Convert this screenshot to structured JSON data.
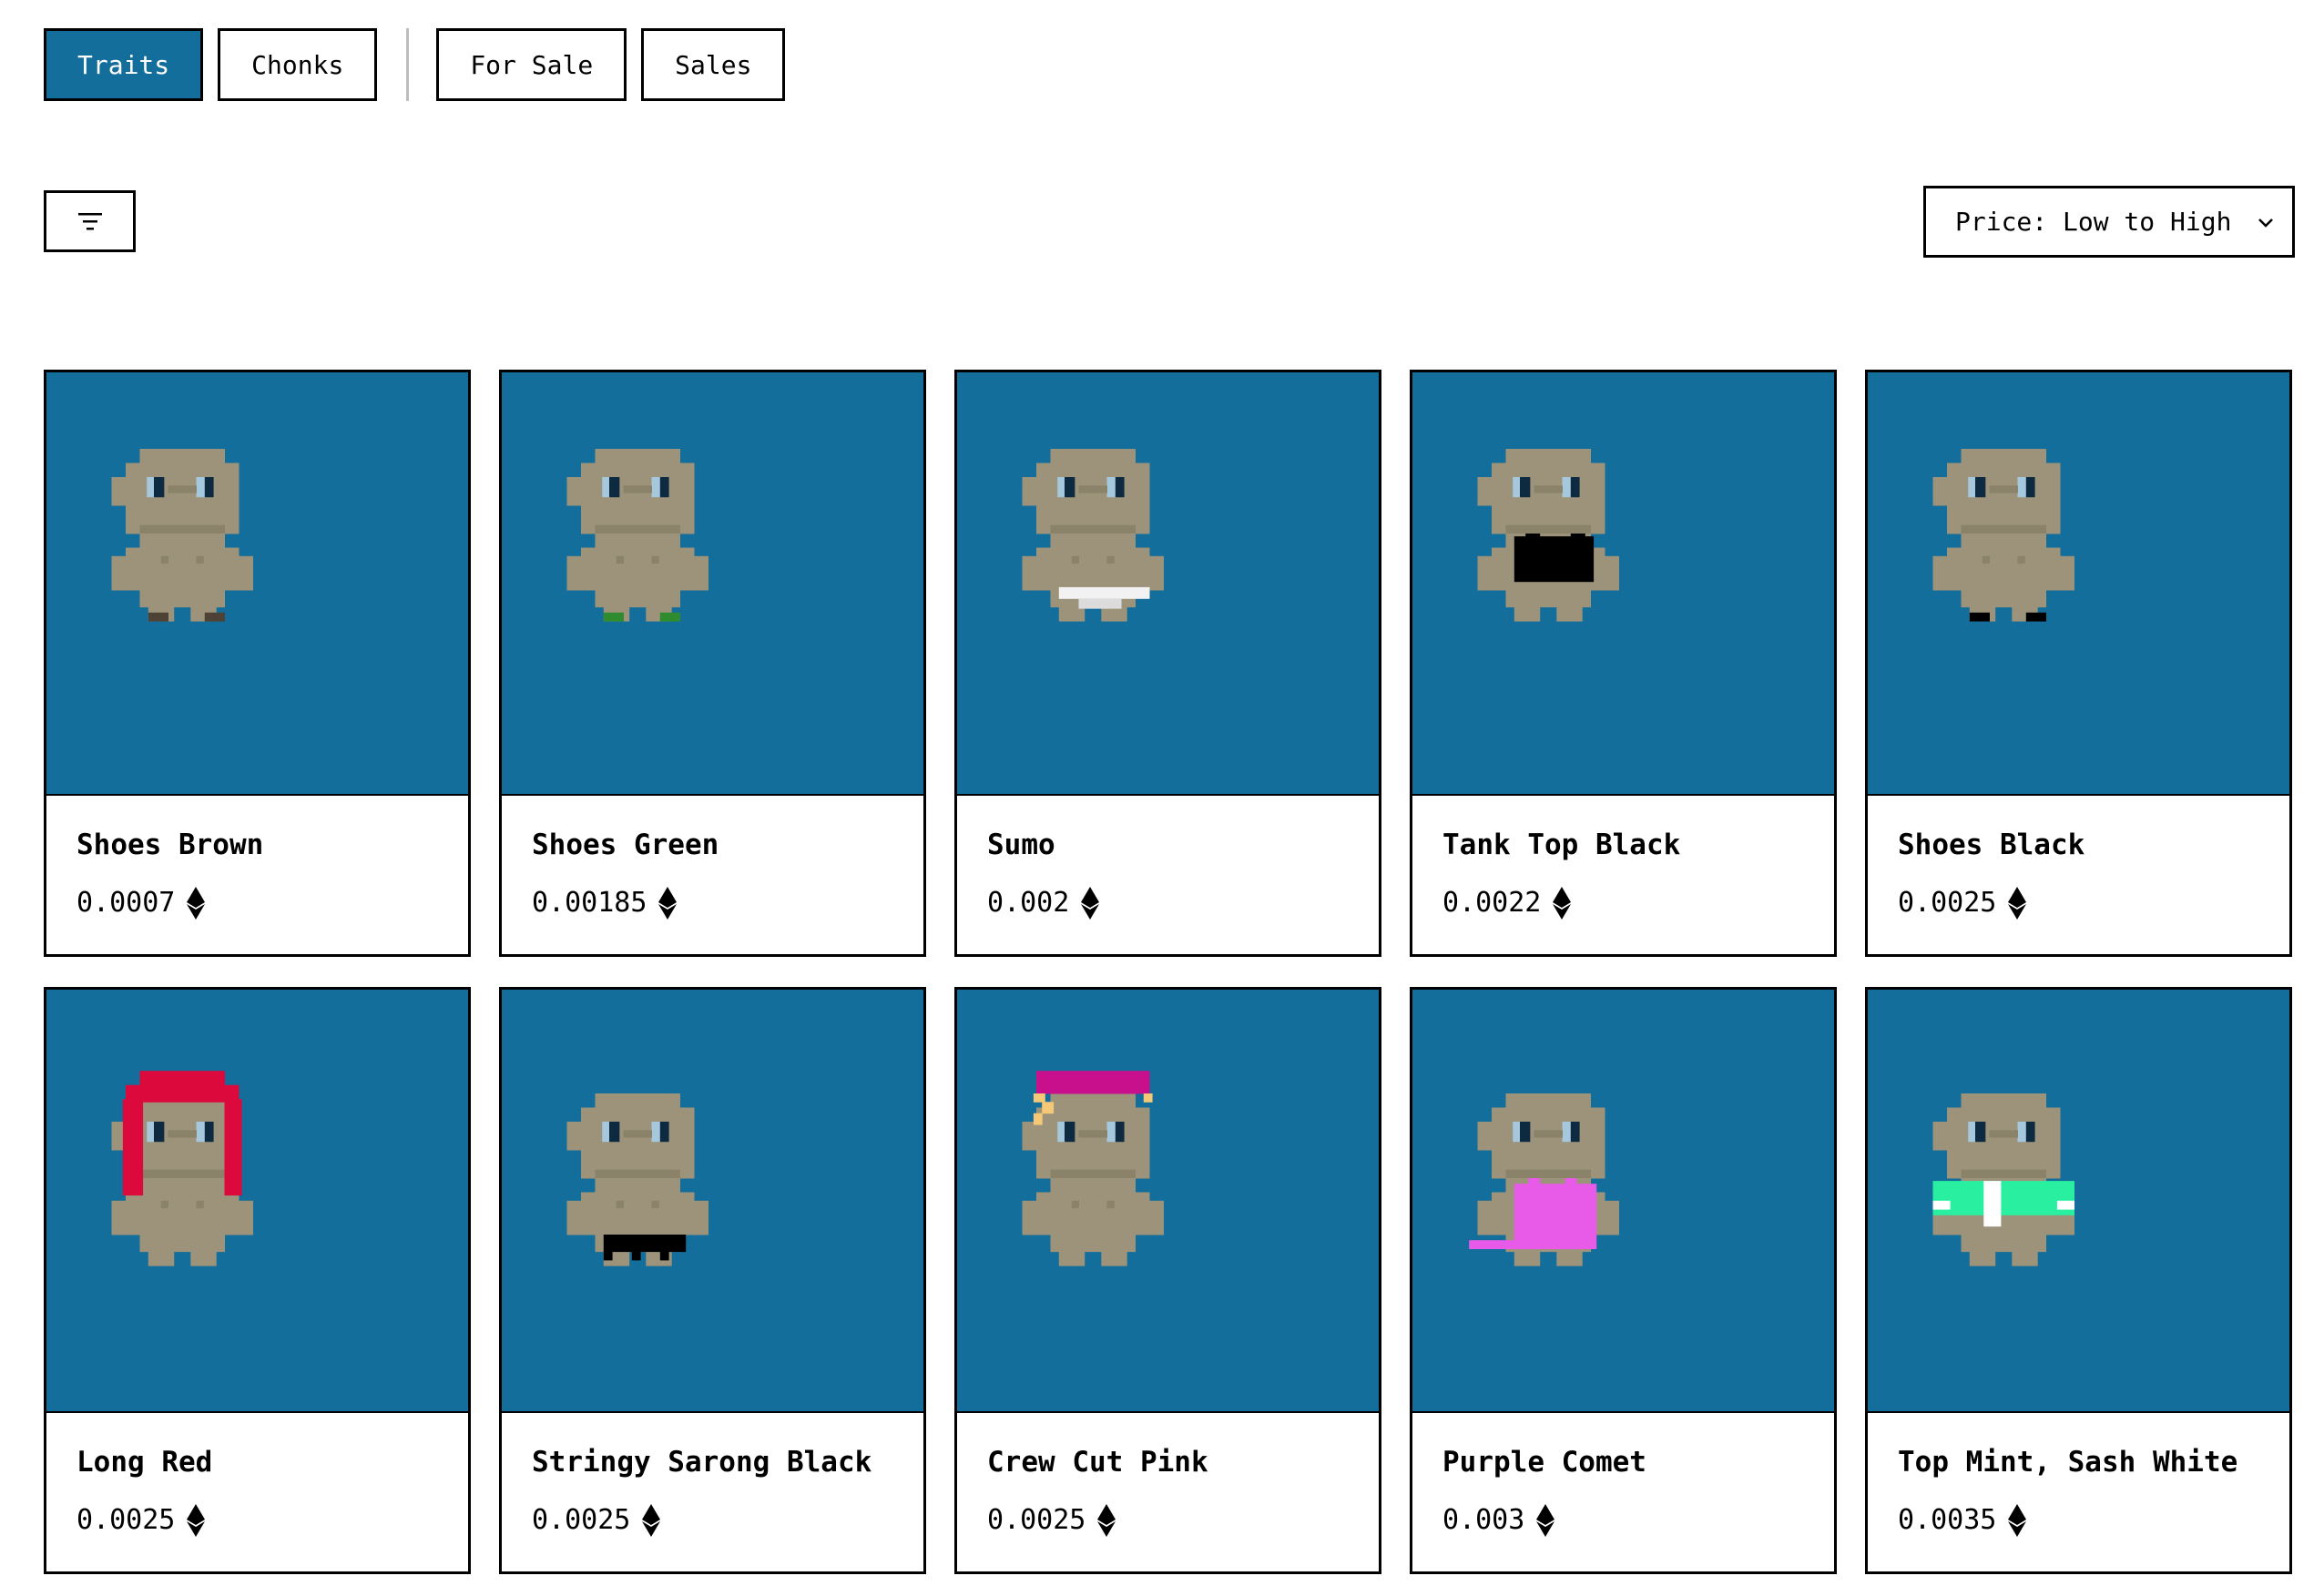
{
  "tabs": [
    {
      "label": "Traits",
      "active": true
    },
    {
      "label": "Chonks",
      "active": false
    },
    {
      "label": "For Sale",
      "active": false
    },
    {
      "label": "Sales",
      "active": false
    }
  ],
  "filter": {
    "icon": "filter-icon"
  },
  "sort": {
    "selected": "Price: Low to High",
    "icon": "chevron-down-icon"
  },
  "colors": {
    "accent": "#146e9c",
    "skin": "#9c937a",
    "skin_dark": "#8a8269"
  },
  "traits": [
    {
      "name": "Shoes Brown",
      "price": "0.0007",
      "trait_color": "#4e4236"
    },
    {
      "name": "Shoes Green",
      "price": "0.00185",
      "trait_color": "#2e8b2e"
    },
    {
      "name": "Sumo",
      "price": "0.002",
      "trait_color": "#f2f2f2"
    },
    {
      "name": "Tank Top Black",
      "price": "0.0022",
      "trait_color": "#000000"
    },
    {
      "name": "Shoes Black",
      "price": "0.0025",
      "trait_color": "#000000"
    },
    {
      "name": "Long Red",
      "price": "0.0025",
      "trait_color": "#dc0a3c"
    },
    {
      "name": "Stringy Sarong Black",
      "price": "0.0025",
      "trait_color": "#000000"
    },
    {
      "name": "Crew Cut Pink",
      "price": "0.0025",
      "trait_color": "#c8108c"
    },
    {
      "name": "Purple Comet",
      "price": "0.003",
      "trait_color": "#e85ae8"
    },
    {
      "name": "Top Mint, Sash White",
      "price": "0.0035",
      "trait_color": "#28f0a0"
    }
  ]
}
